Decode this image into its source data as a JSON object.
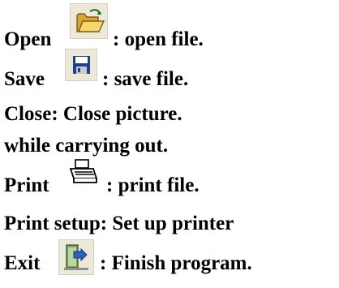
{
  "items": [
    {
      "name": "open",
      "label": "Open",
      "desc": ": open file.",
      "icon": "open-folder-icon"
    },
    {
      "name": "save",
      "label": "Save",
      "desc": ": save file.",
      "icon": "floppy-disk-icon"
    },
    {
      "name": "close",
      "text": "Close: Close picture."
    },
    {
      "name": "while",
      "text": "while carrying out."
    },
    {
      "name": "print",
      "label": "Print",
      "desc": ": print file.",
      "icon": "printer-icon"
    },
    {
      "name": "print-setup",
      "text": "Print setup: Set up printer"
    },
    {
      "name": "exit",
      "label": "Exit",
      "desc": ": Finish program.",
      "icon": "exit-door-icon"
    }
  ],
  "colors": {
    "text": "#000000",
    "icon_bg": "#ece9d8",
    "folder": "#f2c84b",
    "disk": "#1f3f8f"
  }
}
